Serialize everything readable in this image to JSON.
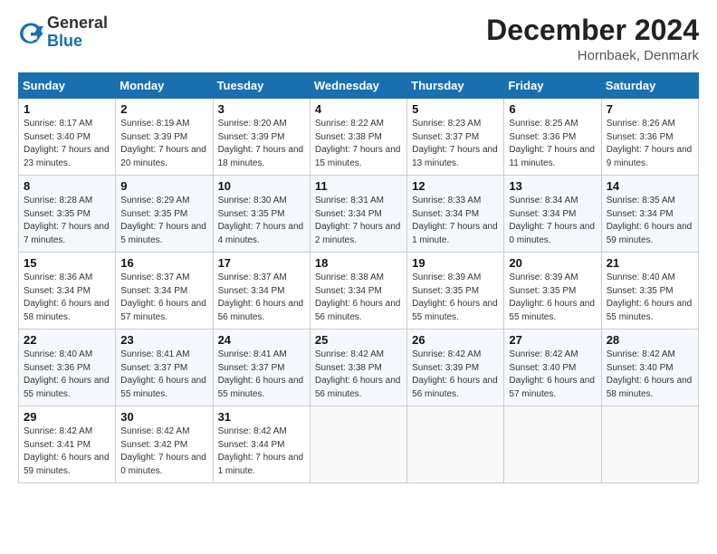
{
  "header": {
    "logo_general": "General",
    "logo_blue": "Blue",
    "month": "December 2024",
    "location": "Hornbaek, Denmark"
  },
  "days_of_week": [
    "Sunday",
    "Monday",
    "Tuesday",
    "Wednesday",
    "Thursday",
    "Friday",
    "Saturday"
  ],
  "weeks": [
    [
      {
        "day": "1",
        "sunrise": "8:17 AM",
        "sunset": "3:40 PM",
        "daylight": "7 hours and 23 minutes."
      },
      {
        "day": "2",
        "sunrise": "8:19 AM",
        "sunset": "3:39 PM",
        "daylight": "7 hours and 20 minutes."
      },
      {
        "day": "3",
        "sunrise": "8:20 AM",
        "sunset": "3:39 PM",
        "daylight": "7 hours and 18 minutes."
      },
      {
        "day": "4",
        "sunrise": "8:22 AM",
        "sunset": "3:38 PM",
        "daylight": "7 hours and 15 minutes."
      },
      {
        "day": "5",
        "sunrise": "8:23 AM",
        "sunset": "3:37 PM",
        "daylight": "7 hours and 13 minutes."
      },
      {
        "day": "6",
        "sunrise": "8:25 AM",
        "sunset": "3:36 PM",
        "daylight": "7 hours and 11 minutes."
      },
      {
        "day": "7",
        "sunrise": "8:26 AM",
        "sunset": "3:36 PM",
        "daylight": "7 hours and 9 minutes."
      }
    ],
    [
      {
        "day": "8",
        "sunrise": "8:28 AM",
        "sunset": "3:35 PM",
        "daylight": "7 hours and 7 minutes."
      },
      {
        "day": "9",
        "sunrise": "8:29 AM",
        "sunset": "3:35 PM",
        "daylight": "7 hours and 5 minutes."
      },
      {
        "day": "10",
        "sunrise": "8:30 AM",
        "sunset": "3:35 PM",
        "daylight": "7 hours and 4 minutes."
      },
      {
        "day": "11",
        "sunrise": "8:31 AM",
        "sunset": "3:34 PM",
        "daylight": "7 hours and 2 minutes."
      },
      {
        "day": "12",
        "sunrise": "8:33 AM",
        "sunset": "3:34 PM",
        "daylight": "7 hours and 1 minute."
      },
      {
        "day": "13",
        "sunrise": "8:34 AM",
        "sunset": "3:34 PM",
        "daylight": "7 hours and 0 minutes."
      },
      {
        "day": "14",
        "sunrise": "8:35 AM",
        "sunset": "3:34 PM",
        "daylight": "6 hours and 59 minutes."
      }
    ],
    [
      {
        "day": "15",
        "sunrise": "8:36 AM",
        "sunset": "3:34 PM",
        "daylight": "6 hours and 58 minutes."
      },
      {
        "day": "16",
        "sunrise": "8:37 AM",
        "sunset": "3:34 PM",
        "daylight": "6 hours and 57 minutes."
      },
      {
        "day": "17",
        "sunrise": "8:37 AM",
        "sunset": "3:34 PM",
        "daylight": "6 hours and 56 minutes."
      },
      {
        "day": "18",
        "sunrise": "8:38 AM",
        "sunset": "3:34 PM",
        "daylight": "6 hours and 56 minutes."
      },
      {
        "day": "19",
        "sunrise": "8:39 AM",
        "sunset": "3:35 PM",
        "daylight": "6 hours and 55 minutes."
      },
      {
        "day": "20",
        "sunrise": "8:39 AM",
        "sunset": "3:35 PM",
        "daylight": "6 hours and 55 minutes."
      },
      {
        "day": "21",
        "sunrise": "8:40 AM",
        "sunset": "3:35 PM",
        "daylight": "6 hours and 55 minutes."
      }
    ],
    [
      {
        "day": "22",
        "sunrise": "8:40 AM",
        "sunset": "3:36 PM",
        "daylight": "6 hours and 55 minutes."
      },
      {
        "day": "23",
        "sunrise": "8:41 AM",
        "sunset": "3:37 PM",
        "daylight": "6 hours and 55 minutes."
      },
      {
        "day": "24",
        "sunrise": "8:41 AM",
        "sunset": "3:37 PM",
        "daylight": "6 hours and 55 minutes."
      },
      {
        "day": "25",
        "sunrise": "8:42 AM",
        "sunset": "3:38 PM",
        "daylight": "6 hours and 56 minutes."
      },
      {
        "day": "26",
        "sunrise": "8:42 AM",
        "sunset": "3:39 PM",
        "daylight": "6 hours and 56 minutes."
      },
      {
        "day": "27",
        "sunrise": "8:42 AM",
        "sunset": "3:40 PM",
        "daylight": "6 hours and 57 minutes."
      },
      {
        "day": "28",
        "sunrise": "8:42 AM",
        "sunset": "3:40 PM",
        "daylight": "6 hours and 58 minutes."
      }
    ],
    [
      {
        "day": "29",
        "sunrise": "8:42 AM",
        "sunset": "3:41 PM",
        "daylight": "6 hours and 59 minutes."
      },
      {
        "day": "30",
        "sunrise": "8:42 AM",
        "sunset": "3:42 PM",
        "daylight": "7 hours and 0 minutes."
      },
      {
        "day": "31",
        "sunrise": "8:42 AM",
        "sunset": "3:44 PM",
        "daylight": "7 hours and 1 minute."
      },
      null,
      null,
      null,
      null
    ]
  ]
}
